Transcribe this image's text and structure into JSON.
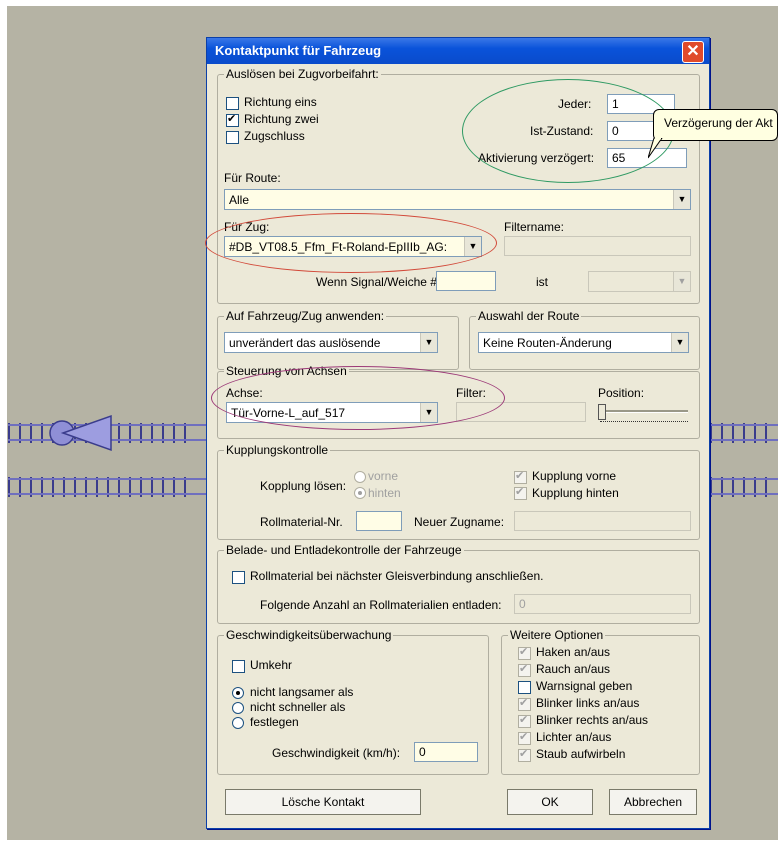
{
  "dialog": {
    "title": "Kontaktpunkt für Fahrzeug"
  },
  "trigger": {
    "legend": "Auslösen bei Zugvorbeifahrt:",
    "checkboxes": [
      {
        "label": "Richtung eins",
        "checked": false
      },
      {
        "label": "Richtung zwei",
        "checked": true
      },
      {
        "label": "Zugschluss",
        "checked": false
      }
    ],
    "jeder_label": "Jeder:",
    "jeder_value": "1",
    "ist_label": "Ist-Zustand:",
    "ist_value": "0",
    "aktiv_label": "Aktivierung verzögert:",
    "aktiv_value": "65",
    "route_label": "Für Route:",
    "route_value": "Alle",
    "zug_label": "Für Zug:",
    "zug_value": "#DB_VT08.5_Ffm_Ft-Roland-EpIIIb_AG:",
    "filtername_label": "Filtername:",
    "signal_label": "Wenn Signal/Weiche #",
    "ist_label2": "ist"
  },
  "tooltip": "Verzögerung der Akt",
  "apply": {
    "legend": "Auf Fahrzeug/Zug anwenden:",
    "value": "unverändert das auslösende"
  },
  "route_select": {
    "legend": "Auswahl der Route",
    "value": "Keine Routen-Änderung"
  },
  "axes": {
    "legend": "Steuerung von Achsen",
    "achse_label": "Achse:",
    "achse_value": "Tür-Vorne-L_auf_517",
    "filter_label": "Filter:",
    "position_label": "Position:"
  },
  "coupling": {
    "legend": "Kupplungskontrolle",
    "loesen_label": "Kopplung lösen:",
    "vorne": "vorne",
    "hinten": "hinten",
    "kupplung_vorne": "Kupplung vorne",
    "kupplung_hinten": "Kupplung hinten",
    "rollmaterial_label": "Rollmaterial-Nr.",
    "zugname_label": "Neuer Zugname:"
  },
  "loading": {
    "legend": "Belade- und Entladekontrolle der Fahrzeuge",
    "checkbox": "Rollmaterial bei nächster Gleisverbindung anschließen.",
    "entladen_label": "Folgende Anzahl an Rollmaterialien entladen:",
    "entladen_value": "0"
  },
  "speed": {
    "legend": "Geschwindigkeitsüberwachung",
    "umkehr": "Umkehr",
    "options": [
      "nicht langsamer als",
      "nicht schneller als",
      "festlegen"
    ],
    "selected": 0,
    "speed_label": "Geschwindigkeit (km/h):",
    "speed_value": "0"
  },
  "options": {
    "legend": "Weitere Optionen",
    "items": [
      {
        "label": "Haken an/aus",
        "checked": true,
        "disabled": true
      },
      {
        "label": "Rauch an/aus",
        "checked": true,
        "disabled": true
      },
      {
        "label": "Warnsignal geben",
        "checked": false,
        "disabled": false
      },
      {
        "label": "Blinker links an/aus",
        "checked": true,
        "disabled": true
      },
      {
        "label": "Blinker rechts an/aus",
        "checked": true,
        "disabled": true
      },
      {
        "label": "Lichter an/aus",
        "checked": true,
        "disabled": true
      },
      {
        "label": "Staub aufwirbeln",
        "checked": true,
        "disabled": true
      }
    ]
  },
  "buttons": {
    "delete": "Lösche Kontakt",
    "ok": "OK",
    "cancel": "Abbrechen"
  }
}
